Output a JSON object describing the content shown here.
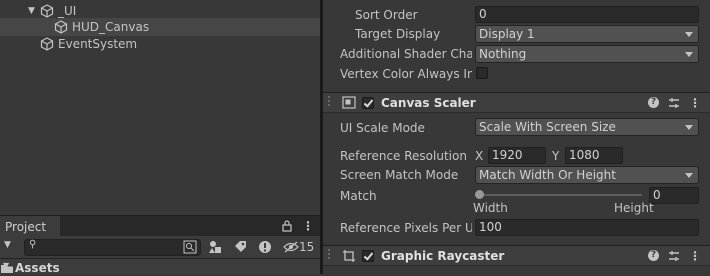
{
  "hierarchy": {
    "items": [
      {
        "label": "_UI",
        "icon": "gameobject-icon",
        "expanded": true
      },
      {
        "label": "HUD_Canvas",
        "icon": "gameobject-icon",
        "selected": true
      },
      {
        "label": "EventSystem",
        "icon": "gameobject-icon"
      }
    ]
  },
  "project": {
    "tab_label": "Project",
    "hidden_count": "15",
    "search_placeholder": "",
    "root_folder": "Assets"
  },
  "inspector": {
    "canvas_rows": {
      "sort_order_label": "Sort Order",
      "sort_order_value": "0",
      "target_display_label": "Target Display",
      "target_display_value": "Display 1",
      "shader_channels_label": "Additional Shader Chan",
      "shader_channels_value": "Nothing",
      "vertex_color_label": "Vertex Color Always In G"
    },
    "canvas_scaler": {
      "title": "Canvas Scaler",
      "ui_scale_mode_label": "UI Scale Mode",
      "ui_scale_mode_value": "Scale With Screen Size",
      "ref_res_label": "Reference Resolution",
      "x_label": "X",
      "x_value": "1920",
      "y_label": "Y",
      "y_value": "1080",
      "match_mode_label": "Screen Match Mode",
      "match_mode_value": "Match Width Or Height",
      "match_label": "Match",
      "match_value": "0",
      "width_label": "Width",
      "height_label": "Height",
      "ppu_label": "Reference Pixels Per Ur",
      "ppu_value": "100"
    },
    "graphic_raycaster": {
      "title": "Graphic Raycaster"
    }
  },
  "colors": {
    "background": "#383838",
    "field_bg": "#2a2a2a",
    "dropdown_bg": "#515151",
    "header_bg": "#3e3e3e"
  }
}
